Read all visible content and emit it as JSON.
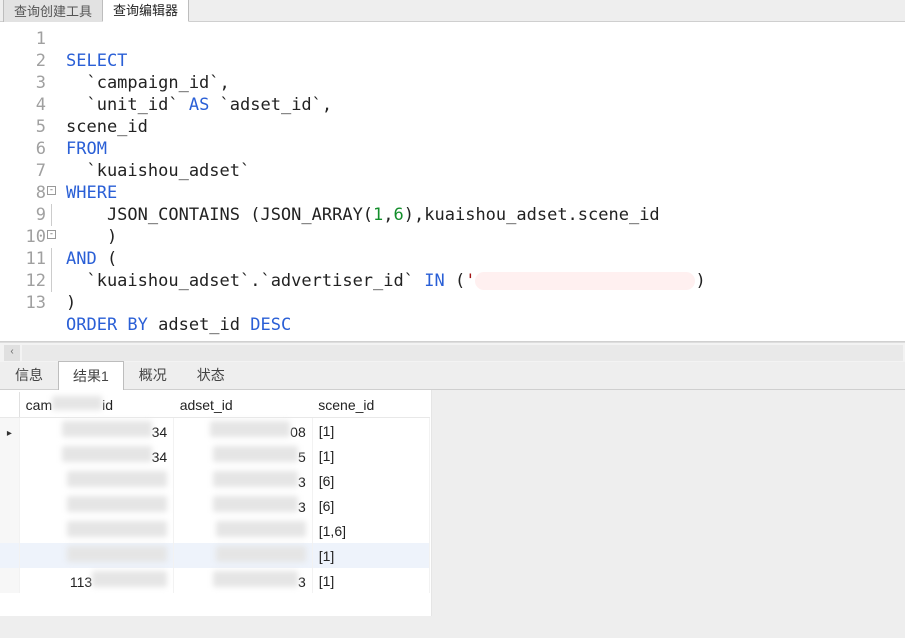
{
  "top_tabs": {
    "builder": "查询创建工具",
    "editor": "查询编辑器"
  },
  "sql": {
    "l1a": "SELECT",
    "l2a": "  `campaign_id`,",
    "l3a": "  `unit_id` ",
    "l3b": "AS",
    "l3c": " `adset_id`,",
    "l4a": "scene_id",
    "l5a": "FROM",
    "l6a": "  `kuaishou_adset`",
    "l7a": "WHERE",
    "l8a": "    JSON_CONTAINS (JSON_ARRAY(",
    "l8n1": "1",
    "l8c": ",",
    "l8n2": "6",
    "l8b": "),kuaishou_adset.scene_id",
    "l9a": "    )",
    "l10a": "AND",
    "l10b": " (",
    "l11a": "  `kuaishou_adset`.`advertiser_id` ",
    "l11b": "IN",
    "l11c": " (",
    "l11q": "'",
    "l11d": ")",
    "l12a": ")",
    "l13a": "ORDER BY",
    "l13b": " adset_id ",
    "l13c": "DESC"
  },
  "gutter": [
    "1",
    "2",
    "3",
    "4",
    "5",
    "6",
    "7",
    "8",
    "9",
    "10",
    "11",
    "12",
    "13"
  ],
  "res_tabs": {
    "info": "信息",
    "result": "结果1",
    "profile": "概况",
    "status": "状态"
  },
  "cols": {
    "campaign": "campaign_id",
    "adset": "adset_id",
    "scene": "scene_id",
    "campaign_short_left": "cam",
    "campaign_short_right": "id"
  },
  "rows": [
    {
      "camp_tail": "34",
      "adset_tail": "08",
      "scene": "[1]"
    },
    {
      "camp_tail": "34",
      "adset_tail": "5",
      "scene": "[1]"
    },
    {
      "camp_tail": "",
      "adset_tail": "3",
      "scene": "[6]"
    },
    {
      "camp_tail": "",
      "adset_tail": "3",
      "scene": "[6]"
    },
    {
      "camp_tail": "",
      "adset_tail": "",
      "scene": "[1,6]"
    },
    {
      "camp_tail": "",
      "adset_tail": "",
      "scene": "[1]"
    },
    {
      "camp_tail": "",
      "adset_tail": "3",
      "scene": "[1]",
      "camp_head": "113"
    }
  ]
}
